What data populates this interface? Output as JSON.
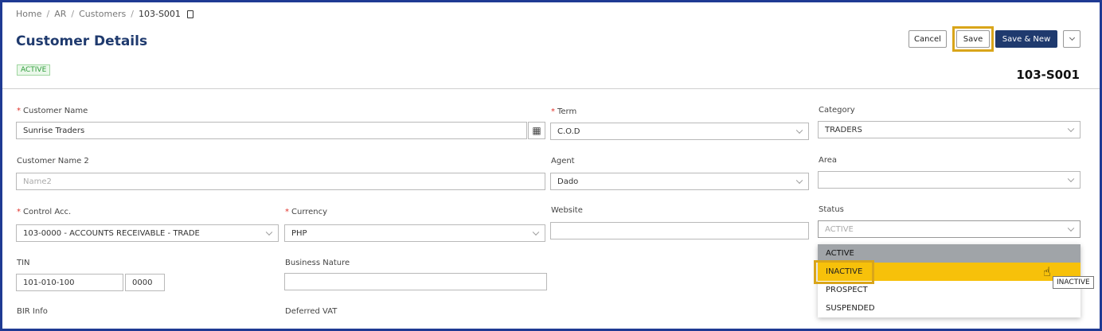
{
  "breadcrumb": {
    "items": [
      "Home",
      "AR",
      "Customers",
      "103-S001"
    ],
    "separator": "/"
  },
  "header": {
    "title": "Customer Details",
    "status_badge": "ACTIVE",
    "doc_number": "103-S001"
  },
  "toolbar": {
    "cancel_label": "Cancel",
    "save_label": "Save",
    "save_new_label": "Save & New"
  },
  "form": {
    "customer_name": {
      "label": "Customer Name",
      "value": "Sunrise Traders"
    },
    "term": {
      "label": "Term",
      "value": "C.O.D"
    },
    "category": {
      "label": "Category",
      "value": "TRADERS"
    },
    "customer_name2": {
      "label": "Customer Name 2",
      "placeholder": "Name2"
    },
    "agent": {
      "label": "Agent",
      "value": "Dado"
    },
    "area": {
      "label": "Area",
      "value": ""
    },
    "control_acc": {
      "label": "Control Acc.",
      "value": "103-0000 - ACCOUNTS RECEIVABLE - TRADE"
    },
    "currency": {
      "label": "Currency",
      "value": "PHP"
    },
    "website": {
      "label": "Website",
      "value": ""
    },
    "status": {
      "label": "Status",
      "value": "ACTIVE"
    },
    "tin": {
      "label": "TIN",
      "value": "101-010-100",
      "branch": "0000"
    },
    "business_nature": {
      "label": "Business Nature",
      "value": ""
    },
    "bir_info": {
      "label": "BIR Info"
    },
    "deferred_vat": {
      "label": "Deferred VAT"
    }
  },
  "status_dropdown": {
    "options": [
      "ACTIVE",
      "INACTIVE",
      "PROSPECT",
      "SUSPENDED"
    ],
    "selected": "ACTIVE",
    "hovered": "INACTIVE",
    "tooltip": "INACTIVE"
  },
  "colors": {
    "accent": "#1f3a6e",
    "frame": "#1f3a93",
    "highlight": "#d9a51a",
    "hover": "#f7c10a",
    "required": "#e0322b"
  },
  "icons": {
    "copy": "copy-icon",
    "qr": "qr-code-icon",
    "chevron": "chevron-down-icon",
    "cursor": "hand-pointer-icon"
  }
}
